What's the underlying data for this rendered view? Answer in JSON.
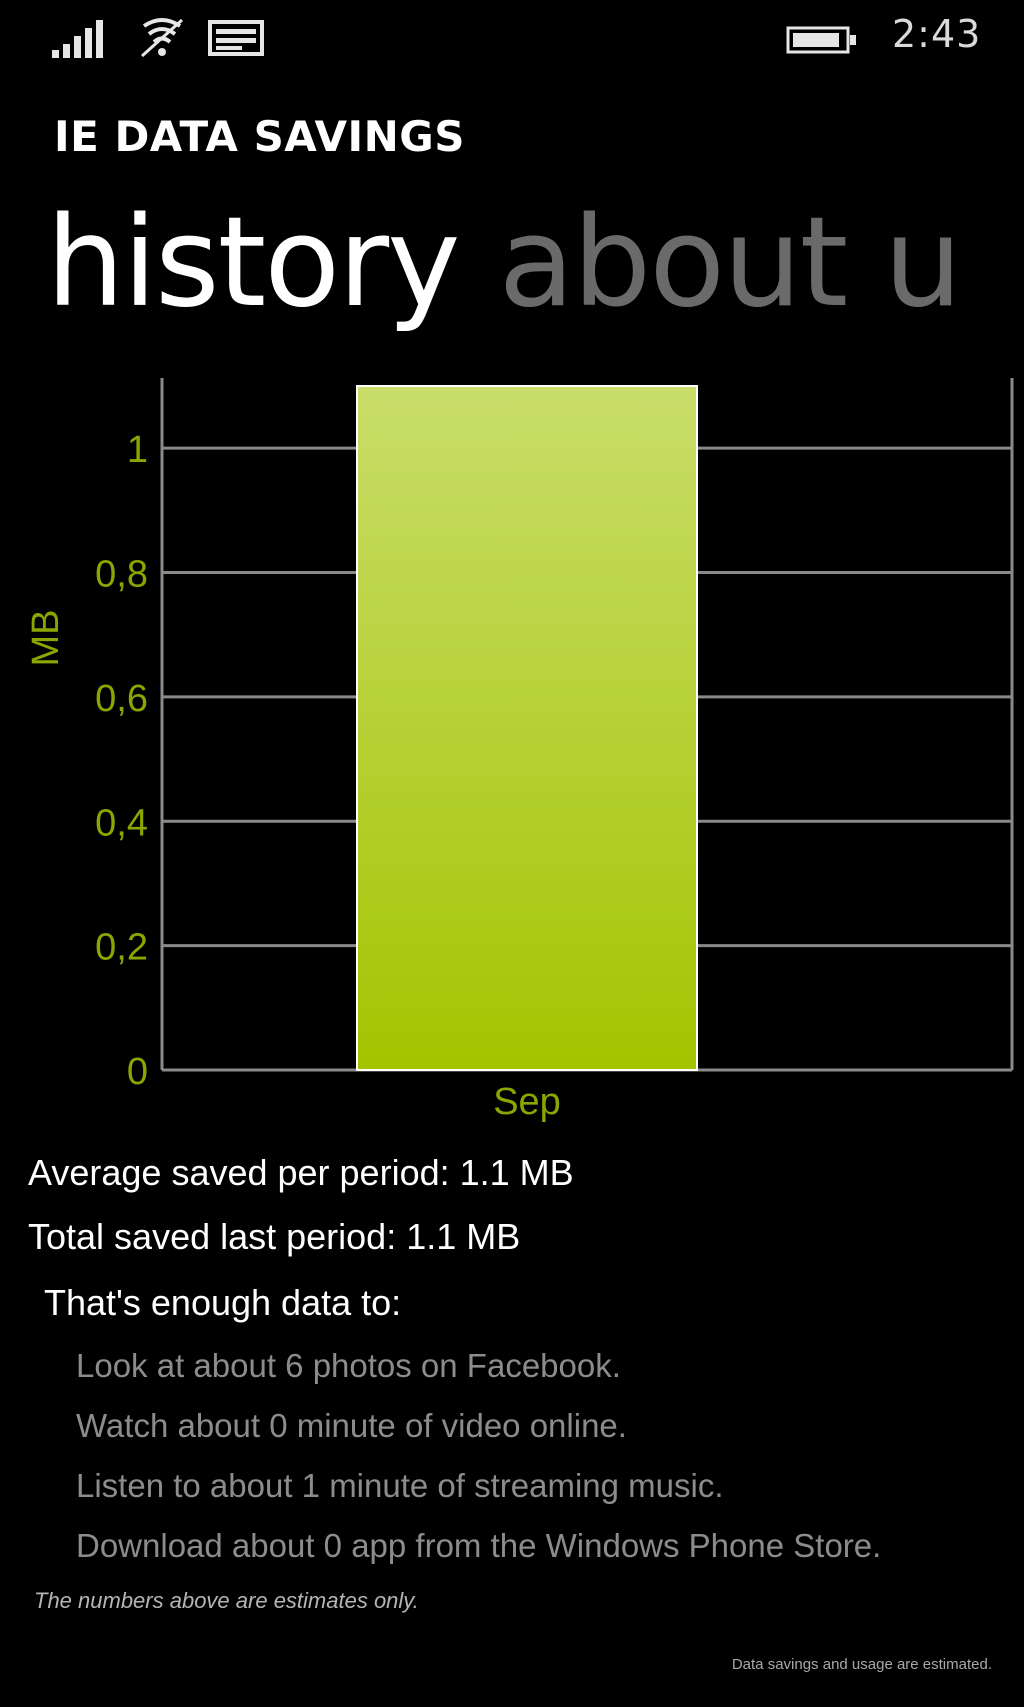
{
  "status_bar": {
    "time": "2:43",
    "icons": [
      "signal-icon",
      "wifi-icon",
      "message-icon",
      "battery-icon"
    ]
  },
  "app_title": "IE DATA SAVINGS",
  "pivot": {
    "tabs": [
      {
        "label": "history",
        "active": true
      },
      {
        "label": "about u",
        "active": false
      }
    ]
  },
  "colors": {
    "accent": "#a4c400",
    "accent_light": "#c9dd6a",
    "axis_label": "#8aa600",
    "gridline": "#8a8a8a",
    "background": "#000000"
  },
  "chart_data": {
    "type": "bar",
    "categories": [
      "Sep"
    ],
    "values": [
      1.1
    ],
    "ylabel": "MB",
    "xlabel": "",
    "ylim": [
      0,
      1.1
    ],
    "yticks": [
      {
        "value": 0,
        "label": "0"
      },
      {
        "value": 0.2,
        "label": "0,2"
      },
      {
        "value": 0.4,
        "label": "0,4"
      },
      {
        "value": 0.6,
        "label": "0,6"
      },
      {
        "value": 0.8,
        "label": "0,8"
      },
      {
        "value": 1,
        "label": "1"
      }
    ],
    "grid": true
  },
  "stats": {
    "average": "Average saved per period: 1.1 MB",
    "total": "Total saved last period: 1.1 MB"
  },
  "enough_heading": "That's enough data to:",
  "examples": [
    "Look at about 6 photos on Facebook.",
    "Watch about 0 minute of video online.",
    "Listen to about 1 minute of streaming music.",
    "Download about 0 app from the Windows Phone Store."
  ],
  "estimate_note": "The numbers above are estimates only.",
  "footer_note": "Data savings and usage are estimated."
}
